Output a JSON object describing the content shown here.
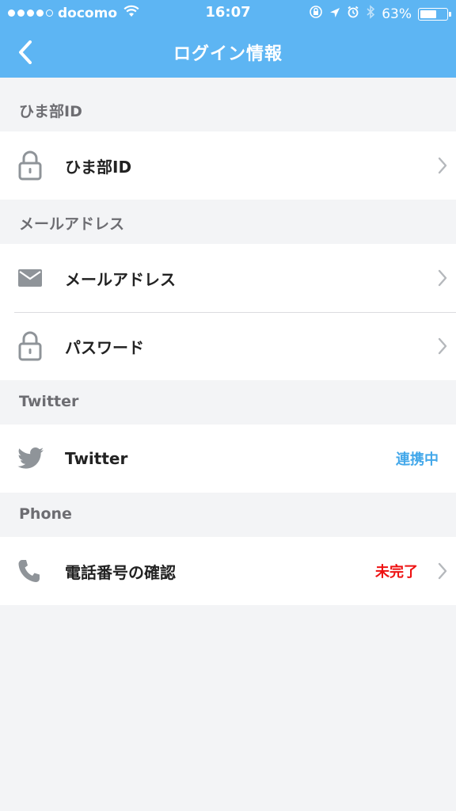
{
  "statusbar": {
    "carrier": "docomo",
    "time": "16:07",
    "battery": "63%",
    "battery_level": 0.63
  },
  "navbar": {
    "title": "ログイン情報",
    "back_icon": "chevron-left-icon"
  },
  "colors": {
    "nav_bg": "#5db5f3",
    "linked": "#44a8ea",
    "incomplete": "#ee1111",
    "icon_gray": "#8f9499"
  },
  "sections": [
    {
      "header": "ひま部ID",
      "rows": [
        {
          "icon": "lock-icon",
          "label": "ひま部ID",
          "status": "",
          "chevron": true
        }
      ]
    },
    {
      "header": "メールアドレス",
      "rows": [
        {
          "icon": "mail-icon",
          "label": "メールアドレス",
          "status": "",
          "chevron": true
        },
        {
          "icon": "lock-icon",
          "label": "パスワード",
          "status": "",
          "chevron": true
        }
      ]
    },
    {
      "header": "Twitter",
      "rows": [
        {
          "icon": "twitter-bird-icon",
          "label": "Twitter",
          "status": "連携中",
          "chevron": false
        }
      ]
    },
    {
      "header": "Phone",
      "rows": [
        {
          "icon": "phone-icon",
          "label": "電話番号の確認",
          "status": "未完了",
          "chevron": true
        }
      ]
    }
  ]
}
